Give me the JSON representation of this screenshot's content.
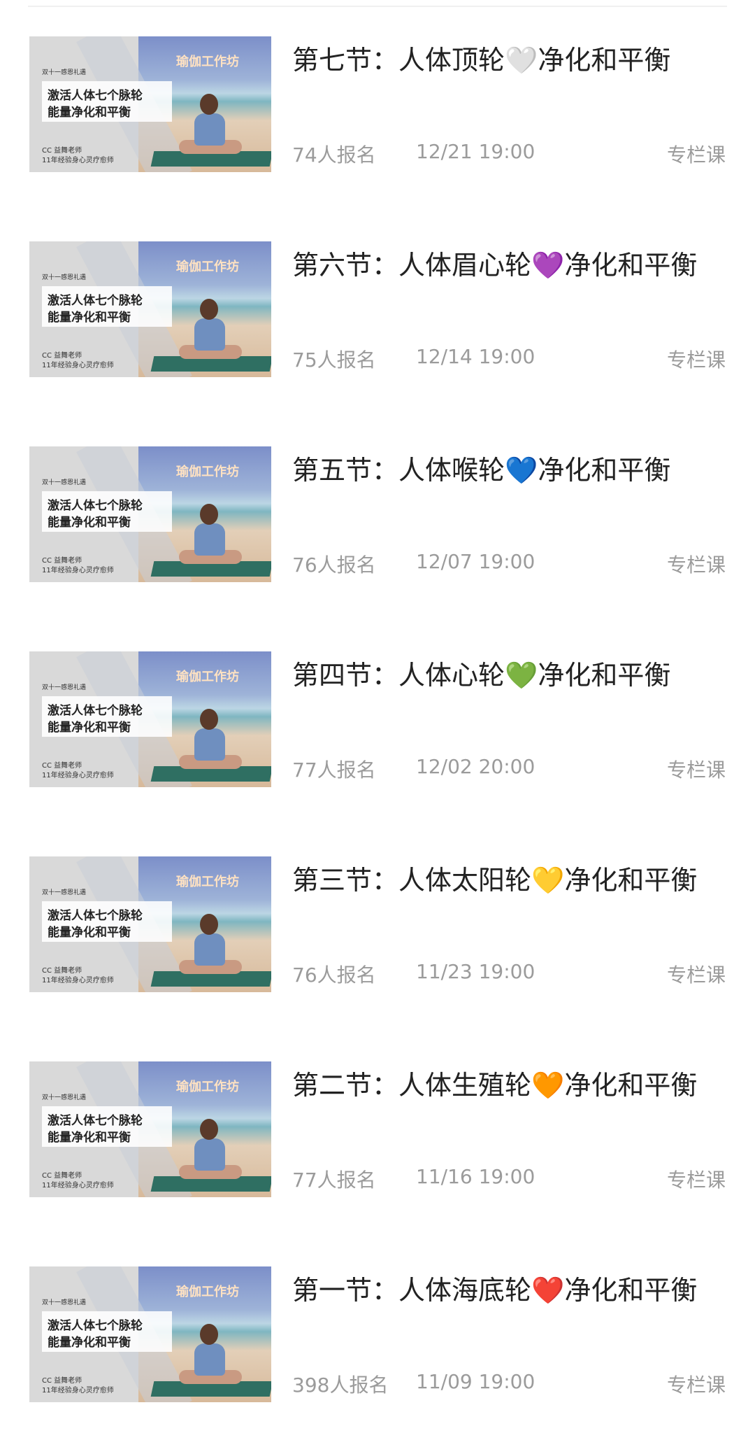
{
  "thumbnail": {
    "top_tag": "双十一感恩礼遇",
    "brand": "瑜伽工作坊",
    "line1": "激活人体七个脉轮",
    "line2": "能量净化和平衡",
    "teacher": "CC 益舞老师",
    "experience": "11年经验身心灵疗愈师"
  },
  "lessons": [
    {
      "title": "第七节：人体顶轮🤍净化和平衡",
      "signups": "74人报名",
      "time": "12/21 19:00",
      "type": "专栏课"
    },
    {
      "title": "第六节：人体眉心轮💜净化和平衡",
      "signups": "75人报名",
      "time": "12/14 19:00",
      "type": "专栏课"
    },
    {
      "title": "第五节：人体喉轮💙净化和平衡",
      "signups": "76人报名",
      "time": "12/07 19:00",
      "type": "专栏课"
    },
    {
      "title": "第四节：人体心轮💚净化和平衡",
      "signups": "77人报名",
      "time": "12/02 20:00",
      "type": "专栏课"
    },
    {
      "title": "第三节：人体太阳轮💛净化和平衡",
      "signups": "76人报名",
      "time": "11/23 19:00",
      "type": "专栏课"
    },
    {
      "title": "第二节：人体生殖轮🧡净化和平衡",
      "signups": "77人报名",
      "time": "11/16 19:00",
      "type": "专栏课"
    },
    {
      "title": "第一节：人体海底轮❤️净化和平衡",
      "signups": "398人报名",
      "time": "11/09 19:00",
      "type": "专栏课"
    }
  ]
}
